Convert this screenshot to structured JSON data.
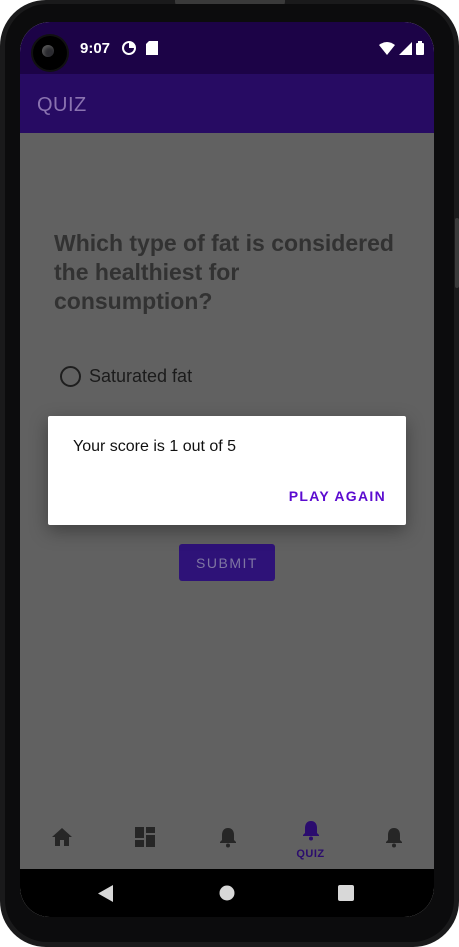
{
  "status_bar": {
    "time": "9:07"
  },
  "app_bar": {
    "title": "QUIZ"
  },
  "quiz": {
    "question": "Which type of fat is considered the healthiest for consumption?",
    "options": [
      {
        "label": "Saturated fat",
        "selected": false
      }
    ],
    "submit_label": "SUBMIT"
  },
  "dialog": {
    "message": "Your score is 1 out of 5",
    "button_label": "PLAY AGAIN"
  },
  "bottom_nav": {
    "items": [
      {
        "icon": "home-icon",
        "label": ""
      },
      {
        "icon": "dashboard-icon",
        "label": ""
      },
      {
        "icon": "bell-icon",
        "label": ""
      },
      {
        "icon": "bell-icon",
        "label": "QUIZ",
        "active": true
      },
      {
        "icon": "bell-icon",
        "label": ""
      }
    ]
  },
  "colors": {
    "status_bar": "#1c0347",
    "app_bar": "#270b63",
    "scrim_background": "#616161",
    "accent": "#5b0bd0",
    "active_nav": "#2b0c6e"
  }
}
